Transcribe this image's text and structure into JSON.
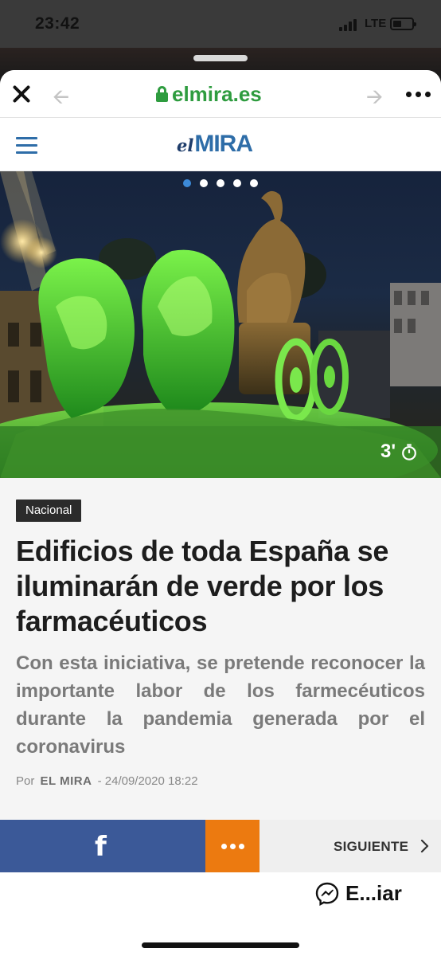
{
  "status_bar": {
    "time": "23:42",
    "network": "LTE"
  },
  "browser": {
    "domain": "elmira.es",
    "lock_color": "#2e9c3f"
  },
  "site": {
    "logo_el": "el",
    "logo_mira": "MIRA",
    "brand_color": "#2e6da8"
  },
  "hero": {
    "carousel_dots": 5,
    "active_dot": 0,
    "read_time": "3'"
  },
  "article": {
    "section": "Nacional",
    "headline": "Edificios de toda España se iluminarán de verde por los farmacéuticos",
    "subtitle": "Con esta iniciativa, se pretende reconocer la importante labor de los farmecéuticos durante la pandemia generada por el coronavirus",
    "byline_prefix": "Por",
    "author": "EL MIRA",
    "date": "- 24/09/2020 18:22"
  },
  "share_bar": {
    "facebook_glyph": "f",
    "next_label": "SIGUIENTE",
    "facebook_color": "#3b5998",
    "more_color": "#ec7a10"
  },
  "bottom": {
    "messenger_label": "E...iar"
  },
  "icons": [
    "close-icon",
    "back-arrow-icon",
    "lock-icon",
    "forward-arrow-icon",
    "more-icon",
    "hamburger-menu-icon",
    "timer-icon",
    "facebook-icon",
    "more-options-icon",
    "chevron-right-icon",
    "messenger-icon"
  ]
}
